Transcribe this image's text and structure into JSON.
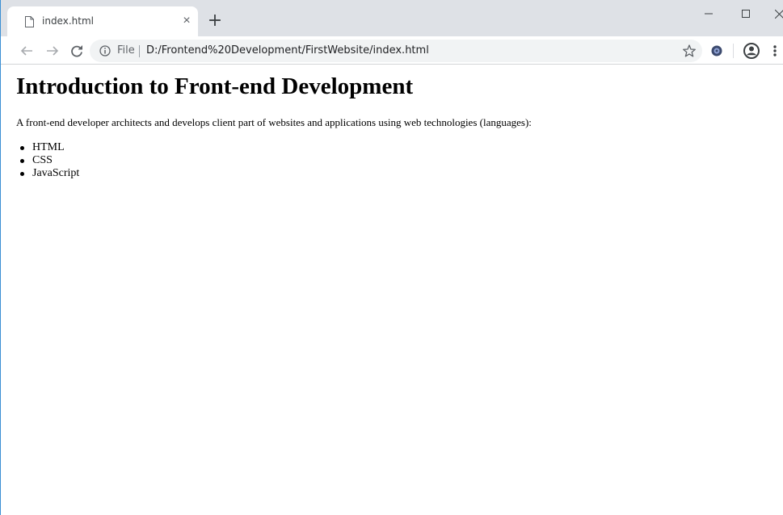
{
  "browser": {
    "tab": {
      "title": "index.html",
      "close_glyph": "×"
    },
    "new_tab_glyph": "+",
    "window_controls": {
      "minimize": "minimize-icon",
      "maximize": "maximize-icon",
      "close": "close-icon"
    },
    "toolbar": {
      "back_icon": "back-arrow-icon",
      "forward_icon": "forward-arrow-icon",
      "reload_icon": "reload-icon",
      "site_info_icon": "info-icon",
      "scheme_label": "File",
      "url": "D:/Frontend%20Development/FirstWebsite/index.html",
      "bookmark_icon": "star-icon",
      "extension_icon": "extension-icon",
      "profile_icon": "profile-icon",
      "menu_icon": "menu-dots-icon"
    }
  },
  "page": {
    "heading": "Introduction to Front-end Development",
    "paragraph": "A front-end developer architects and develops client part of websites and applications using web technologies (languages):",
    "list": [
      "HTML",
      "CSS",
      "JavaScript"
    ]
  },
  "colors": {
    "tabstrip_bg": "#dee1e6",
    "omnibox_bg": "#f1f3f4",
    "window_border": "#3a8fd4"
  }
}
